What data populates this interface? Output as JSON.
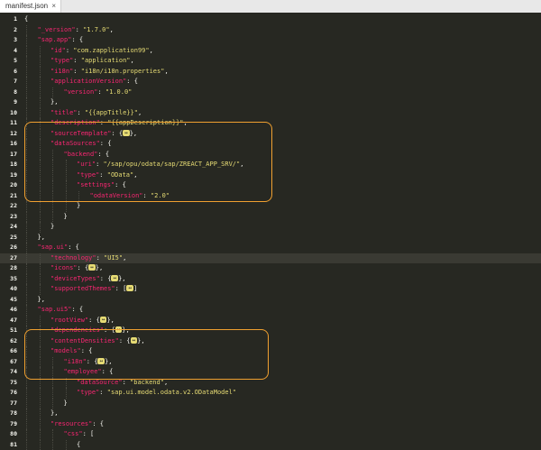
{
  "tab": {
    "title": "manifest.json",
    "close_glyph": "×"
  },
  "lines": [
    {
      "n": "1",
      "indent": 0,
      "parts": [
        [
          "p",
          "{"
        ]
      ]
    },
    {
      "n": "2",
      "indent": 1,
      "parts": [
        [
          "k",
          "\"_version\""
        ],
        [
          "p",
          ": "
        ],
        [
          "s",
          "\"1.7.0\""
        ],
        [
          "p",
          ","
        ]
      ]
    },
    {
      "n": "3",
      "indent": 1,
      "parts": [
        [
          "k",
          "\"sap.app\""
        ],
        [
          "p",
          ": {"
        ]
      ]
    },
    {
      "n": "4",
      "indent": 2,
      "parts": [
        [
          "k",
          "\"id\""
        ],
        [
          "p",
          ": "
        ],
        [
          "s",
          "\"com.zapplication99\""
        ],
        [
          "p",
          ","
        ]
      ]
    },
    {
      "n": "5",
      "indent": 2,
      "parts": [
        [
          "k",
          "\"type\""
        ],
        [
          "p",
          ": "
        ],
        [
          "s",
          "\"application\""
        ],
        [
          "p",
          ","
        ]
      ]
    },
    {
      "n": "6",
      "indent": 2,
      "parts": [
        [
          "k",
          "\"i18n\""
        ],
        [
          "p",
          ": "
        ],
        [
          "s",
          "\"i18n/i18n.properties\""
        ],
        [
          "p",
          ","
        ]
      ]
    },
    {
      "n": "7",
      "indent": 2,
      "parts": [
        [
          "k",
          "\"applicationVersion\""
        ],
        [
          "p",
          ": {"
        ]
      ]
    },
    {
      "n": "8",
      "indent": 3,
      "parts": [
        [
          "k",
          "\"version\""
        ],
        [
          "p",
          ": "
        ],
        [
          "s",
          "\"1.0.0\""
        ]
      ]
    },
    {
      "n": "9",
      "indent": 2,
      "parts": [
        [
          "p",
          "},"
        ]
      ]
    },
    {
      "n": "10",
      "indent": 2,
      "parts": [
        [
          "k",
          "\"title\""
        ],
        [
          "p",
          ": "
        ],
        [
          "s",
          "\"{{appTitle}}\""
        ],
        [
          "p",
          ","
        ]
      ]
    },
    {
      "n": "11",
      "indent": 2,
      "parts": [
        [
          "k",
          "\"description\""
        ],
        [
          "p",
          ": "
        ],
        [
          "s",
          "\"{{appDescription}}\""
        ],
        [
          "p",
          ","
        ]
      ]
    },
    {
      "n": "12",
      "indent": 2,
      "parts": [
        [
          "k",
          "\"sourceTemplate\""
        ],
        [
          "p",
          ": {"
        ],
        [
          "fold",
          "↔"
        ],
        [
          "p",
          "},"
        ]
      ]
    },
    {
      "n": "16",
      "indent": 2,
      "parts": [
        [
          "k",
          "\"dataSources\""
        ],
        [
          "p",
          ": {"
        ]
      ]
    },
    {
      "n": "17",
      "indent": 3,
      "parts": [
        [
          "k",
          "\"backend\""
        ],
        [
          "p",
          ": {"
        ]
      ]
    },
    {
      "n": "18",
      "indent": 4,
      "parts": [
        [
          "k",
          "\"uri\""
        ],
        [
          "p",
          ": "
        ],
        [
          "s",
          "\"/sap/opu/odata/sap/ZREACT_APP_SRV/\""
        ],
        [
          "p",
          ","
        ]
      ]
    },
    {
      "n": "19",
      "indent": 4,
      "parts": [
        [
          "k",
          "\"type\""
        ],
        [
          "p",
          ": "
        ],
        [
          "s",
          "\"OData\""
        ],
        [
          "p",
          ","
        ]
      ]
    },
    {
      "n": "20",
      "indent": 4,
      "parts": [
        [
          "k",
          "\"settings\""
        ],
        [
          "p",
          ": {"
        ]
      ]
    },
    {
      "n": "21",
      "indent": 5,
      "parts": [
        [
          "k",
          "\"odataVersion\""
        ],
        [
          "p",
          ": "
        ],
        [
          "s",
          "\"2.0\""
        ]
      ]
    },
    {
      "n": "22",
      "indent": 4,
      "parts": [
        [
          "p",
          "}"
        ]
      ]
    },
    {
      "n": "23",
      "indent": 3,
      "parts": [
        [
          "p",
          "}"
        ]
      ]
    },
    {
      "n": "24",
      "indent": 2,
      "parts": [
        [
          "p",
          "}"
        ]
      ]
    },
    {
      "n": "25",
      "indent": 1,
      "parts": [
        [
          "p",
          "},"
        ]
      ]
    },
    {
      "n": "26",
      "indent": 1,
      "parts": [
        [
          "k",
          "\"sap.ui\""
        ],
        [
          "p",
          ": {"
        ]
      ]
    },
    {
      "n": "27",
      "indent": 2,
      "current": true,
      "parts": [
        [
          "k",
          "\"technology\""
        ],
        [
          "p",
          ": "
        ],
        [
          "s",
          "\"UI5\""
        ],
        [
          "p",
          ","
        ]
      ]
    },
    {
      "n": "28",
      "indent": 2,
      "parts": [
        [
          "k",
          "\"icons\""
        ],
        [
          "p",
          ": {"
        ],
        [
          "fold",
          "↔"
        ],
        [
          "p",
          "},"
        ]
      ]
    },
    {
      "n": "35",
      "indent": 2,
      "parts": [
        [
          "k",
          "\"deviceTypes\""
        ],
        [
          "p",
          ": {"
        ],
        [
          "fold",
          "↔"
        ],
        [
          "p",
          "},"
        ]
      ]
    },
    {
      "n": "40",
      "indent": 2,
      "parts": [
        [
          "k",
          "\"supportedThemes\""
        ],
        [
          "p",
          ": ["
        ],
        [
          "fold",
          "↔"
        ],
        [
          "p",
          "]"
        ]
      ]
    },
    {
      "n": "45",
      "indent": 1,
      "parts": [
        [
          "p",
          "},"
        ]
      ]
    },
    {
      "n": "46",
      "indent": 1,
      "parts": [
        [
          "k",
          "\"sap.ui5\""
        ],
        [
          "p",
          ": {"
        ]
      ]
    },
    {
      "n": "47",
      "indent": 2,
      "parts": [
        [
          "k",
          "\"rootView\""
        ],
        [
          "p",
          ": {"
        ],
        [
          "fold",
          "↔"
        ],
        [
          "p",
          "},"
        ]
      ]
    },
    {
      "n": "51",
      "indent": 2,
      "parts": [
        [
          "k",
          "\"dependencies\""
        ],
        [
          "p",
          ": {"
        ],
        [
          "fold",
          "↔"
        ],
        [
          "p",
          "},"
        ]
      ]
    },
    {
      "n": "62",
      "indent": 2,
      "parts": [
        [
          "k",
          "\"contentDensities\""
        ],
        [
          "p",
          ": {"
        ],
        [
          "fold",
          "↔"
        ],
        [
          "p",
          "},"
        ]
      ]
    },
    {
      "n": "66",
      "indent": 2,
      "parts": [
        [
          "k",
          "\"models\""
        ],
        [
          "p",
          ": {"
        ]
      ]
    },
    {
      "n": "67",
      "indent": 3,
      "parts": [
        [
          "k",
          "\"i18n\""
        ],
        [
          "p",
          ": {"
        ],
        [
          "fold",
          "↔"
        ],
        [
          "p",
          "},"
        ]
      ]
    },
    {
      "n": "74",
      "indent": 3,
      "parts": [
        [
          "k",
          "\"employee\""
        ],
        [
          "p",
          ": {"
        ]
      ]
    },
    {
      "n": "75",
      "indent": 4,
      "parts": [
        [
          "k",
          "\"dataSource\""
        ],
        [
          "p",
          ": "
        ],
        [
          "s",
          "\"backend\""
        ],
        [
          "p",
          ","
        ]
      ]
    },
    {
      "n": "76",
      "indent": 4,
      "parts": [
        [
          "k",
          "\"type\""
        ],
        [
          "p",
          ": "
        ],
        [
          "s",
          "\"sap.ui.model.odata.v2.ODataModel\""
        ]
      ]
    },
    {
      "n": "77",
      "indent": 3,
      "parts": [
        [
          "p",
          "}"
        ]
      ]
    },
    {
      "n": "78",
      "indent": 2,
      "parts": [
        [
          "p",
          "},"
        ]
      ]
    },
    {
      "n": "79",
      "indent": 2,
      "parts": [
        [
          "k",
          "\"resources\""
        ],
        [
          "p",
          ": {"
        ]
      ]
    },
    {
      "n": "80",
      "indent": 3,
      "parts": [
        [
          "k",
          "\"css\""
        ],
        [
          "p",
          ": ["
        ]
      ]
    },
    {
      "n": "81",
      "indent": 4,
      "parts": [
        [
          "p",
          "{"
        ]
      ]
    }
  ]
}
